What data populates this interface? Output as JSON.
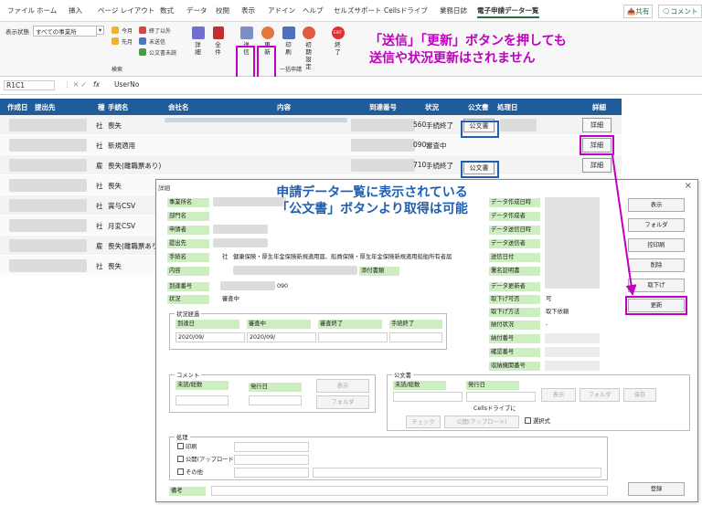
{
  "ribbon_tabs": [
    "ファイル",
    "ホーム",
    "挿入",
    "ページ レイアウト",
    "数式",
    "データ",
    "校閲",
    "表示",
    "アドイン",
    "ヘルプ",
    "セルズサポート",
    "Cellsドライブ",
    "業務日誌",
    "電子申請データ一覧"
  ],
  "share_label": "共有",
  "comment_label": "コメント",
  "ribbon": {
    "display_state_label": "表示状態",
    "display_state_value": "すべての事業所",
    "today": "今月",
    "prev_month": "先月",
    "completed_other": "終了以外",
    "unsent": "未送信",
    "public_doc_unread": "公文書未読",
    "search_group": "検索",
    "detail": "詳細",
    "all": "全件",
    "send": "送信",
    "update": "更新",
    "print": "印刷",
    "initial_setting": "初期設定",
    "end": "終了",
    "batch_group": "一括申請",
    "exit_icon_text": "EXIT"
  },
  "callout_top": [
    "「送信」「更新」ボタンを押しても",
    "送信や状況更新はされません"
  ],
  "formula_bar": {
    "name_box": "R1C1",
    "fx": "fx",
    "value": "UserNo"
  },
  "columns": [
    "作成日",
    "提出先",
    "種",
    "手続名",
    "会社名",
    "内容",
    "到達番号",
    "状況",
    "公文書",
    "処理日",
    "詳細"
  ],
  "rows": [
    {
      "kind": "社",
      "name": "喪失",
      "arrival": "560",
      "status": "手続終了",
      "doc": "公文書",
      "detail": "詳細"
    },
    {
      "kind": "社",
      "name": "新規適用",
      "arrival": "090",
      "status": "審査中",
      "doc": "",
      "detail": "詳細"
    },
    {
      "kind": "雇",
      "name": "喪失(離職票あり)",
      "arrival": "710",
      "status": "手続終了",
      "doc": "公文書",
      "detail": "詳細"
    },
    {
      "kind": "社",
      "name": "喪失",
      "arrival": "",
      "status": "",
      "doc": "",
      "detail": ""
    },
    {
      "kind": "社",
      "name": "賞与CSV",
      "arrival": "",
      "status": "",
      "doc": "",
      "detail": ""
    },
    {
      "kind": "社",
      "name": "月変CSV",
      "arrival": "",
      "status": "",
      "doc": "",
      "detail": ""
    },
    {
      "kind": "雇",
      "name": "喪失(離職票あり)",
      "arrival": "",
      "status": "",
      "doc": "",
      "detail": ""
    },
    {
      "kind": "社",
      "name": "喪失",
      "arrival": "",
      "status": "",
      "doc": "",
      "detail": ""
    }
  ],
  "dialog": {
    "title": "詳細",
    "close": "×",
    "labels": {
      "office": "事業所名",
      "dept": "部門名",
      "applicant": "申請者",
      "submit_to": "提出先",
      "proc_name": "手続名",
      "content": "内容",
      "arrival_no": "到達番号",
      "status": "状況",
      "data_created": "データ作成日時",
      "data_creator": "データ作成者",
      "data_sent": "データ送信日時",
      "data_sender": "データ送信者",
      "send_date": "送信日付",
      "signer": "署名証明書",
      "data_updater": "データ更新者",
      "withdraw_possible": "取下げ可否",
      "withdraw_method": "取下げ方法",
      "payment_status": "納付状況",
      "payment_no": "納付番号",
      "confirm_no": "確認番号",
      "agency_no": "収納機関番号",
      "attach_docs": "添付書類"
    },
    "values": {
      "proc_kind": "社",
      "proc_text": "健康保険・厚生年金保険新規適用届、船員保険・厚生年金保険新規適用船舶所有者届",
      "arrival_suffix": "090",
      "status": "審査中",
      "withdraw_possible": "可",
      "withdraw_method": "取下依頼",
      "payment_status": "-"
    },
    "progress": {
      "title": "状況経過",
      "cols": [
        "到達日",
        "審査中",
        "審査終了",
        "手続終了"
      ],
      "date1": "2020/09/",
      "date2": "2020/09/"
    },
    "comment": {
      "title": "コメント",
      "unread": "未読/総数",
      "issue_date": "発行日",
      "show": "表示",
      "folder": "フォルダ"
    },
    "public_doc": {
      "title": "公文書",
      "unread": "未読/総数",
      "issue_date": "発行日",
      "show": "表示",
      "folder": "フォルダ",
      "save": "保存",
      "cells_drive": "Cellsドライブに",
      "check": "チェック",
      "publish": "公開(アップロード)",
      "select": "選択式"
    },
    "process": {
      "title": "処理",
      "print": "印刷",
      "publish": "公開(アップロード)",
      "other": "その他"
    },
    "remarks": "備考",
    "side_buttons": {
      "show": "表示",
      "folder": "フォルダ",
      "ack_print": "控印刷",
      "delete": "削除",
      "withdraw": "取下げ",
      "update": "更新",
      "register": "登録"
    }
  },
  "callout_mid": [
    "申請データ一覧に表示されている",
    "「公文書」ボタンより取得は可能"
  ],
  "colors": {
    "highlight": "#c000c0",
    "header": "#1f5c99",
    "label_bg": "#cdeec0",
    "callout_mid": "#1f5fb3"
  }
}
